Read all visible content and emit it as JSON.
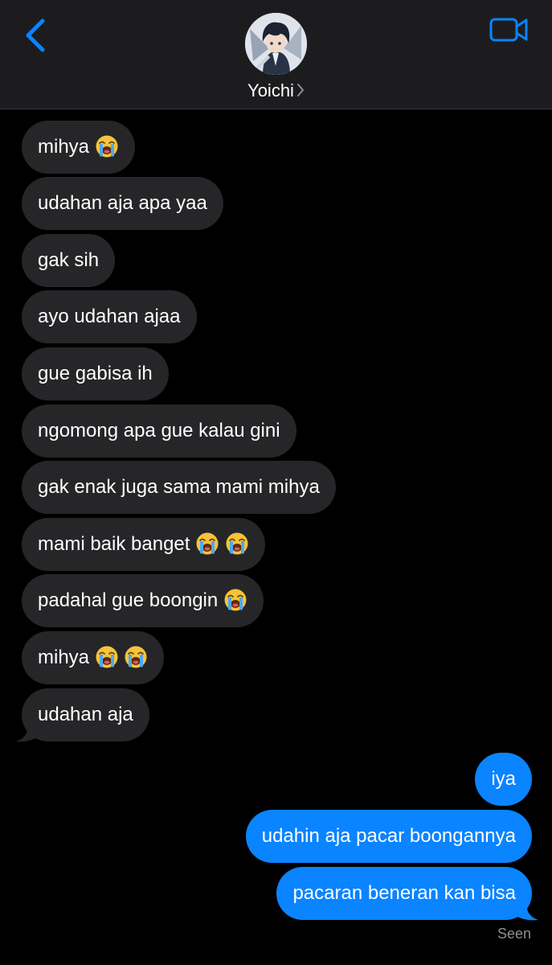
{
  "header": {
    "contact_name": "Yoichi",
    "back_icon": "chevron-left-icon",
    "video_icon": "video-camera-icon",
    "accent_color": "#0a84ff"
  },
  "messages": {
    "incoming": [
      {
        "text": "mihya",
        "emoji": 1
      },
      {
        "text": "udahan aja apa yaa",
        "emoji": 0
      },
      {
        "text": "gak sih",
        "emoji": 0
      },
      {
        "text": "ayo udahan ajaa",
        "emoji": 0
      },
      {
        "text": "gue gabisa ih",
        "emoji": 0
      },
      {
        "text": "ngomong apa gue kalau gini",
        "emoji": 0
      },
      {
        "text": "gak enak juga sama mami mihya",
        "emoji": 0
      },
      {
        "text": "mami baik banget",
        "emoji": 2
      },
      {
        "text": "padahal gue boongin",
        "emoji": 1
      },
      {
        "text": "mihya",
        "emoji": 2
      },
      {
        "text": "udahan aja",
        "emoji": 0
      }
    ],
    "outgoing": [
      {
        "text": "iya"
      },
      {
        "text": "udahin aja pacar boongannya"
      },
      {
        "text": "pacaran beneran kan bisa"
      }
    ],
    "emoji_icon": "loudly-crying-face-icon",
    "incoming_color": "#262628",
    "outgoing_color": "#0a84ff"
  },
  "status": {
    "read_receipt": "Seen"
  }
}
